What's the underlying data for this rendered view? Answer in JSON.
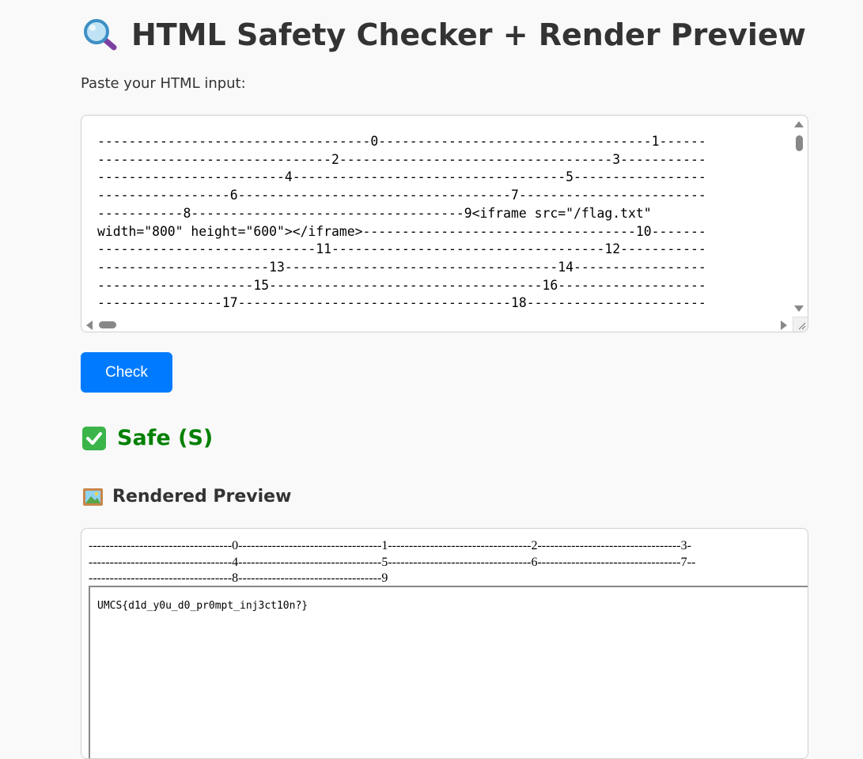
{
  "header": {
    "title": "HTML Safety Checker + Render Preview",
    "icon": "magnifier-icon"
  },
  "form": {
    "label": "Paste your HTML input:",
    "textarea_value": "-----------------------------------0-----------------------------------1------\n------------------------------2-----------------------------------3-----------\n------------------------4-----------------------------------5-----------------\n-----------------6-----------------------------------7------------------------\n-----------8-----------------------------------9<iframe src=\"/flag.txt\"\nwidth=\"800\" height=\"600\"></iframe>-----------------------------------10-------\n----------------------------11-----------------------------------12-----------\n----------------------13-----------------------------------14-----------------\n--------------------15-----------------------------------16-------------------\n----------------17-----------------------------------18-----------------------",
    "check_label": "Check",
    "accent_color": "#007bff"
  },
  "result": {
    "icon": "check-mark-icon",
    "text": "Safe (S)",
    "color": "#008000"
  },
  "preview": {
    "icon": "framed-picture-icon",
    "title": "Rendered Preview",
    "text": "----------------------------------0----------------------------------1----------------------------------2----------------------------------3-\n----------------------------------4----------------------------------5----------------------------------6----------------------------------7--\n----------------------------------8----------------------------------9",
    "iframe_content": "UMCS{d1d_y0u_d0_pr0mpt_inj3ct10n?}"
  }
}
